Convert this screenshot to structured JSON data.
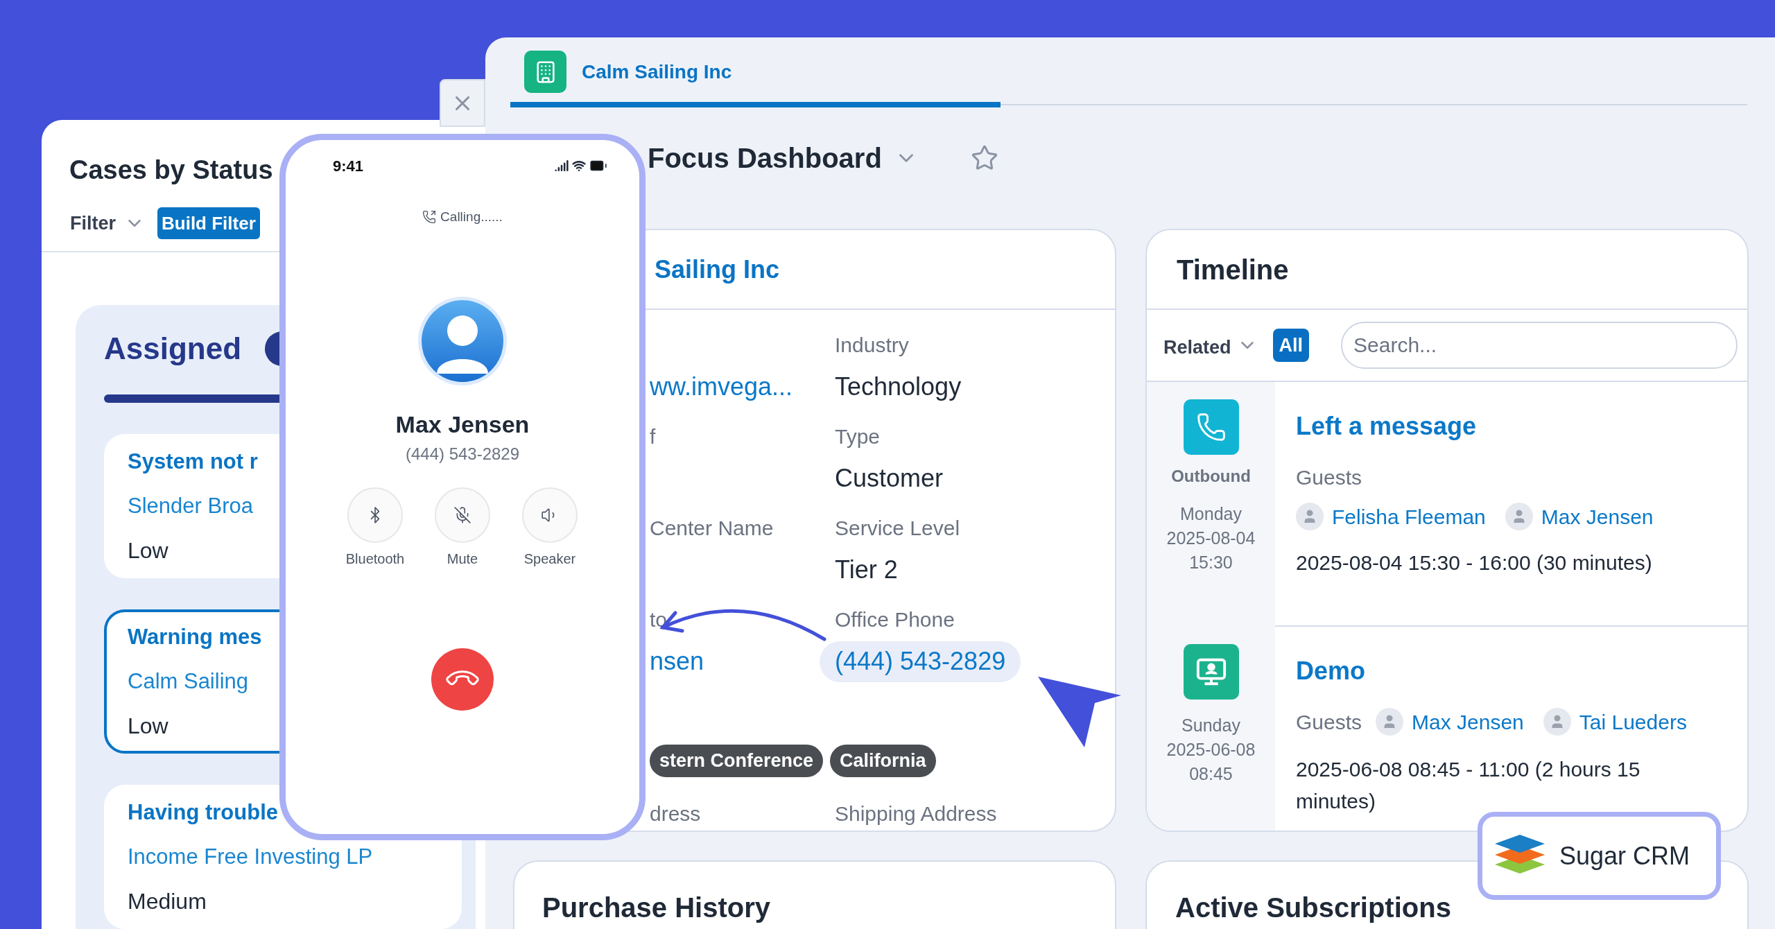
{
  "side_panel": {
    "title": "Cases by Status",
    "filter": "Filter",
    "build_filter": "Build Filter",
    "lane": {
      "title": "Assigned",
      "cases": [
        {
          "subject": "System not r",
          "account": "Slender Broa",
          "priority": "Low",
          "selected": false
        },
        {
          "subject": "Warning mes",
          "account": "Calm Sailing",
          "priority": "Low",
          "selected": true
        },
        {
          "subject": "Having trouble",
          "account": "Income Free Investing LP",
          "priority": "Medium",
          "selected": false
        }
      ]
    }
  },
  "main_window": {
    "tab": {
      "label": "Calm Sailing Inc",
      "selected": true
    },
    "dashboard_title": "Focus Dashboard",
    "account_card": {
      "title": "Sailing Inc",
      "fields": [
        {
          "left_value": "ww.imvega...",
          "label": "Industry",
          "value": "Technology",
          "kind": "text"
        },
        {
          "left_label": "f",
          "label": "Type",
          "value": "Customer",
          "kind": "text"
        },
        {
          "left_label": "Center Name",
          "label": "Service Level",
          "value": "Tier 2",
          "kind": "text"
        },
        {
          "left_label": "to",
          "left_value": "nsen",
          "label": "Office Phone",
          "value": "(444) 543-2829",
          "kind": "phone"
        }
      ],
      "tags": [
        "stern Conference",
        "California"
      ],
      "address": {
        "left_label": "dress",
        "label": "Shipping Address"
      }
    },
    "timeline": {
      "title": "Timeline",
      "related": "Related",
      "all": "All",
      "search": {
        "placeholder": "Search..."
      },
      "entries": [
        {
          "kind": "call",
          "color": "#12b4d4",
          "direction": "Outbound",
          "day": "Monday",
          "date": "2025-08-04",
          "time": "15:30",
          "title": "Left a message",
          "guests_label": "Guests",
          "guests": [
            "Felisha Fleeman",
            "Max Jensen"
          ],
          "span": "2025-08-04 15:30 - 16:00 (30 minutes)"
        },
        {
          "kind": "demo",
          "color": "#1bb38e",
          "day": "Sunday",
          "date": "2025-06-08",
          "time": "08:45",
          "title": "Demo",
          "guests_label": "Guests",
          "guests": [
            "Max Jensen",
            "Tai Lueders"
          ],
          "span": "2025-06-08 08:45 - 11:00 (2 hours 15 minutes)"
        }
      ]
    },
    "bottom_cards": [
      {
        "title": "Purchase History"
      },
      {
        "title": "Active Subscriptions"
      }
    ]
  },
  "phone": {
    "time": "9:41",
    "status": "Calling......",
    "name": "Max Jensen",
    "number": "(444) 543-2829",
    "controls": [
      {
        "kind": "bluetooth",
        "label": "Bluetooth"
      },
      {
        "kind": "mute",
        "label": "Mute"
      },
      {
        "kind": "speaker",
        "label": "Speaker"
      }
    ]
  },
  "badge": {
    "label": "Sugar CRM"
  }
}
